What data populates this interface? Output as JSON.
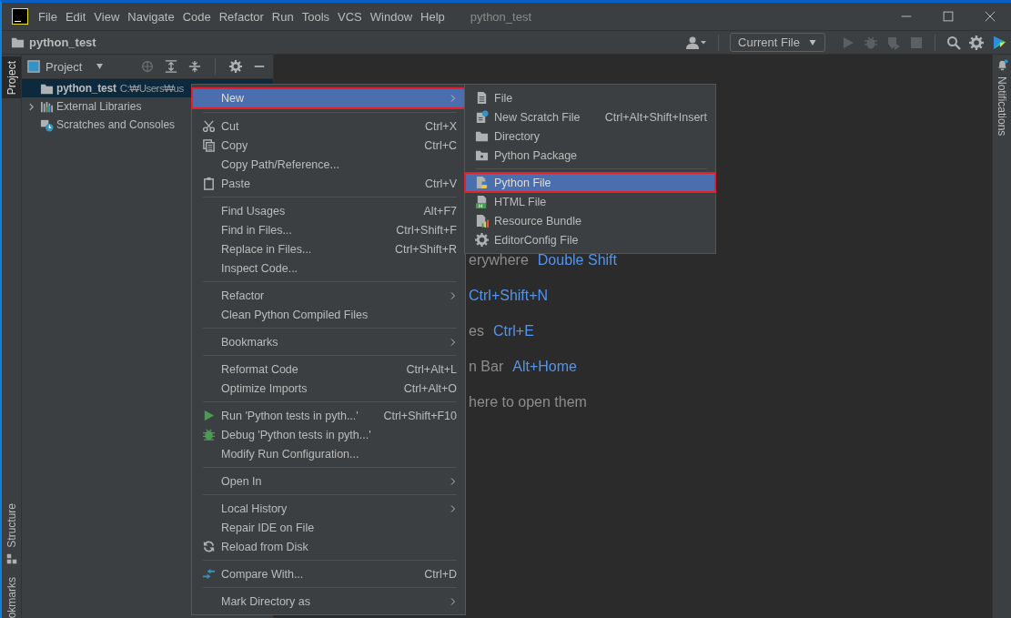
{
  "window": {
    "title": "python_test",
    "menus": [
      "File",
      "Edit",
      "View",
      "Navigate",
      "Code",
      "Refactor",
      "Run",
      "Tools",
      "VCS",
      "Window",
      "Help"
    ]
  },
  "navigation_bar": {
    "project": "python_test",
    "run_configuration": "Current File",
    "toolbar_buttons": [
      {
        "disabled": false
      },
      {
        "disabled": true
      },
      {
        "disabled": true
      },
      {
        "disabled": true
      },
      {
        "disabled": true
      },
      {
        "disabled": false
      },
      {
        "disabled": false
      },
      {
        "disabled": false
      }
    ]
  },
  "left_stripe": [
    {
      "label": "Project",
      "selected": true
    },
    {
      "label": "Structure",
      "selected": false
    },
    {
      "label": "okmarks",
      "selected": false
    }
  ],
  "right_stripe": [
    {
      "label": "Notifications",
      "selected": false
    }
  ],
  "project_panel": {
    "title": "Project",
    "tree": [
      {
        "label": "python_test",
        "path": "C:₩Users₩us",
        "selected": true
      },
      {
        "label": "External Libraries",
        "expanded": false,
        "selected": false
      },
      {
        "label": "Scratches and Consoles",
        "selected": false
      }
    ]
  },
  "editor": {
    "hints": [
      {
        "text": "erywhere",
        "shortcut": "Double Shift"
      },
      {
        "shortcut": "Ctrl+Shift+N"
      },
      {
        "text": "es",
        "shortcut": "Ctrl+E"
      },
      {
        "text": "n Bar",
        "shortcut": "Alt+Home"
      },
      {
        "text": "here to open them"
      }
    ]
  },
  "context_menu": {
    "groups": [
      {
        "items": [
          {
            "label": "New",
            "submenu": true,
            "selected": true,
            "annotated": true
          }
        ]
      },
      {
        "items": [
          {
            "label": "Cut",
            "shortcut": "Ctrl+X",
            "selected": false,
            "annotated": false
          },
          {
            "label": "Copy",
            "shortcut": "Ctrl+C",
            "selected": false,
            "annotated": false
          },
          {
            "label": "Copy Path/Reference...",
            "selected": false,
            "annotated": false
          },
          {
            "label": "Paste",
            "shortcut": "Ctrl+V",
            "selected": false,
            "annotated": false
          }
        ]
      },
      {
        "items": [
          {
            "label": "Find Usages",
            "shortcut": "Alt+F7",
            "selected": false,
            "annotated": false
          },
          {
            "label": "Find in Files...",
            "shortcut": "Ctrl+Shift+F",
            "selected": false,
            "annotated": false
          },
          {
            "label": "Replace in Files...",
            "shortcut": "Ctrl+Shift+R",
            "selected": false,
            "annotated": false
          },
          {
            "label": "Inspect Code...",
            "selected": false,
            "annotated": false
          }
        ]
      },
      {
        "items": [
          {
            "label": "Refactor",
            "submenu": true,
            "selected": false,
            "annotated": false
          },
          {
            "label": "Clean Python Compiled Files",
            "selected": false,
            "annotated": false
          }
        ]
      },
      {
        "items": [
          {
            "label": "Bookmarks",
            "submenu": true,
            "selected": false,
            "annotated": false
          }
        ]
      },
      {
        "items": [
          {
            "label": "Reformat Code",
            "shortcut": "Ctrl+Alt+L",
            "selected": false,
            "annotated": false
          },
          {
            "label": "Optimize Imports",
            "shortcut": "Ctrl+Alt+O",
            "selected": false,
            "annotated": false
          }
        ]
      },
      {
        "items": [
          {
            "label": "Run 'Python tests in pyth...'",
            "shortcut": "Ctrl+Shift+F10",
            "selected": false,
            "annotated": false
          },
          {
            "label": "Debug 'Python tests in pyth...'",
            "selected": false,
            "annotated": false
          },
          {
            "label": "Modify Run Configuration...",
            "selected": false,
            "annotated": false
          }
        ]
      },
      {
        "items": [
          {
            "label": "Open In",
            "submenu": true,
            "selected": false,
            "annotated": false
          }
        ]
      },
      {
        "items": [
          {
            "label": "Local History",
            "submenu": true,
            "selected": false,
            "annotated": false
          },
          {
            "label": "Repair IDE on File",
            "selected": false,
            "annotated": false
          },
          {
            "label": "Reload from Disk",
            "selected": false,
            "annotated": false
          }
        ]
      },
      {
        "items": [
          {
            "label": "Compare With...",
            "shortcut": "Ctrl+D",
            "selected": false,
            "annotated": false
          }
        ]
      },
      {
        "items": [
          {
            "label": "Mark Directory as",
            "submenu": true,
            "selected": false,
            "annotated": false
          }
        ]
      }
    ]
  },
  "submenu": {
    "groups": [
      {
        "items": [
          {
            "label": "File",
            "selected": false,
            "annotated": false
          },
          {
            "label": "New Scratch File",
            "shortcut": "Ctrl+Alt+Shift+Insert",
            "selected": false,
            "annotated": false
          },
          {
            "label": "Directory",
            "selected": false,
            "annotated": false
          },
          {
            "label": "Python Package",
            "selected": false,
            "annotated": false
          }
        ]
      },
      {
        "items": [
          {
            "label": "Python File",
            "selected": true,
            "annotated": true
          },
          {
            "label": "HTML File",
            "selected": false,
            "annotated": false
          },
          {
            "label": "Resource Bundle",
            "selected": false,
            "annotated": false
          },
          {
            "label": "EditorConfig File",
            "selected": false,
            "annotated": false
          }
        ]
      }
    ]
  }
}
